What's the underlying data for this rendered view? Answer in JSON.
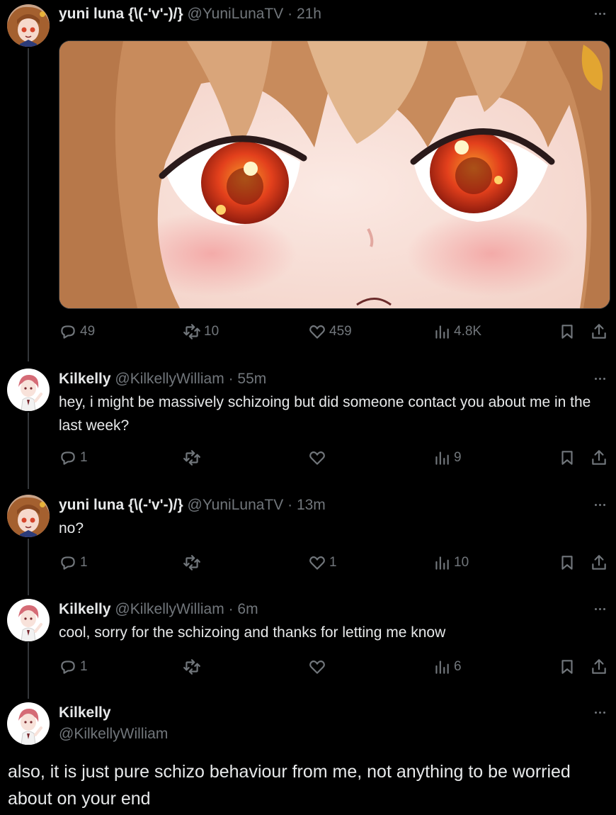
{
  "tweets": [
    {
      "name": "yuni luna {\\(-'v'-)/}",
      "handle": "@YuniLunaTV",
      "sep": "·",
      "time": "21h",
      "text": "",
      "replies": "49",
      "reposts": "10",
      "likes": "459",
      "views": "4.8K"
    },
    {
      "name": "Kilkelly",
      "handle": "@KilkellyWilliam",
      "sep": "·",
      "time": "55m",
      "text": "hey, i might be massively schizoing but did someone contact you about me in the last week?",
      "replies": "1",
      "reposts": "",
      "likes": "",
      "views": "9"
    },
    {
      "name": "yuni luna {\\(-'v'-)/}",
      "handle": "@YuniLunaTV",
      "sep": "·",
      "time": "13m",
      "text": "no?",
      "replies": "1",
      "reposts": "",
      "likes": "1",
      "views": "10"
    },
    {
      "name": "Kilkelly",
      "handle": "@KilkellyWilliam",
      "sep": "·",
      "time": "6m",
      "text": "cool, sorry for the schizoing and thanks for letting me know",
      "replies": "1",
      "reposts": "",
      "likes": "",
      "views": "6"
    }
  ],
  "focused": {
    "name": "Kilkelly",
    "handle": "@KilkellyWilliam",
    "text": "also, it is just pure schizo behaviour from me, not anything to be worried about on your end"
  },
  "colors": {
    "background": "#000000",
    "text": "#e7e9ea",
    "muted": "#71767b",
    "thread_line": "#333639"
  },
  "icons": [
    "reply-icon",
    "repost-icon",
    "like-icon",
    "views-icon",
    "bookmark-icon",
    "share-icon",
    "more-icon"
  ]
}
